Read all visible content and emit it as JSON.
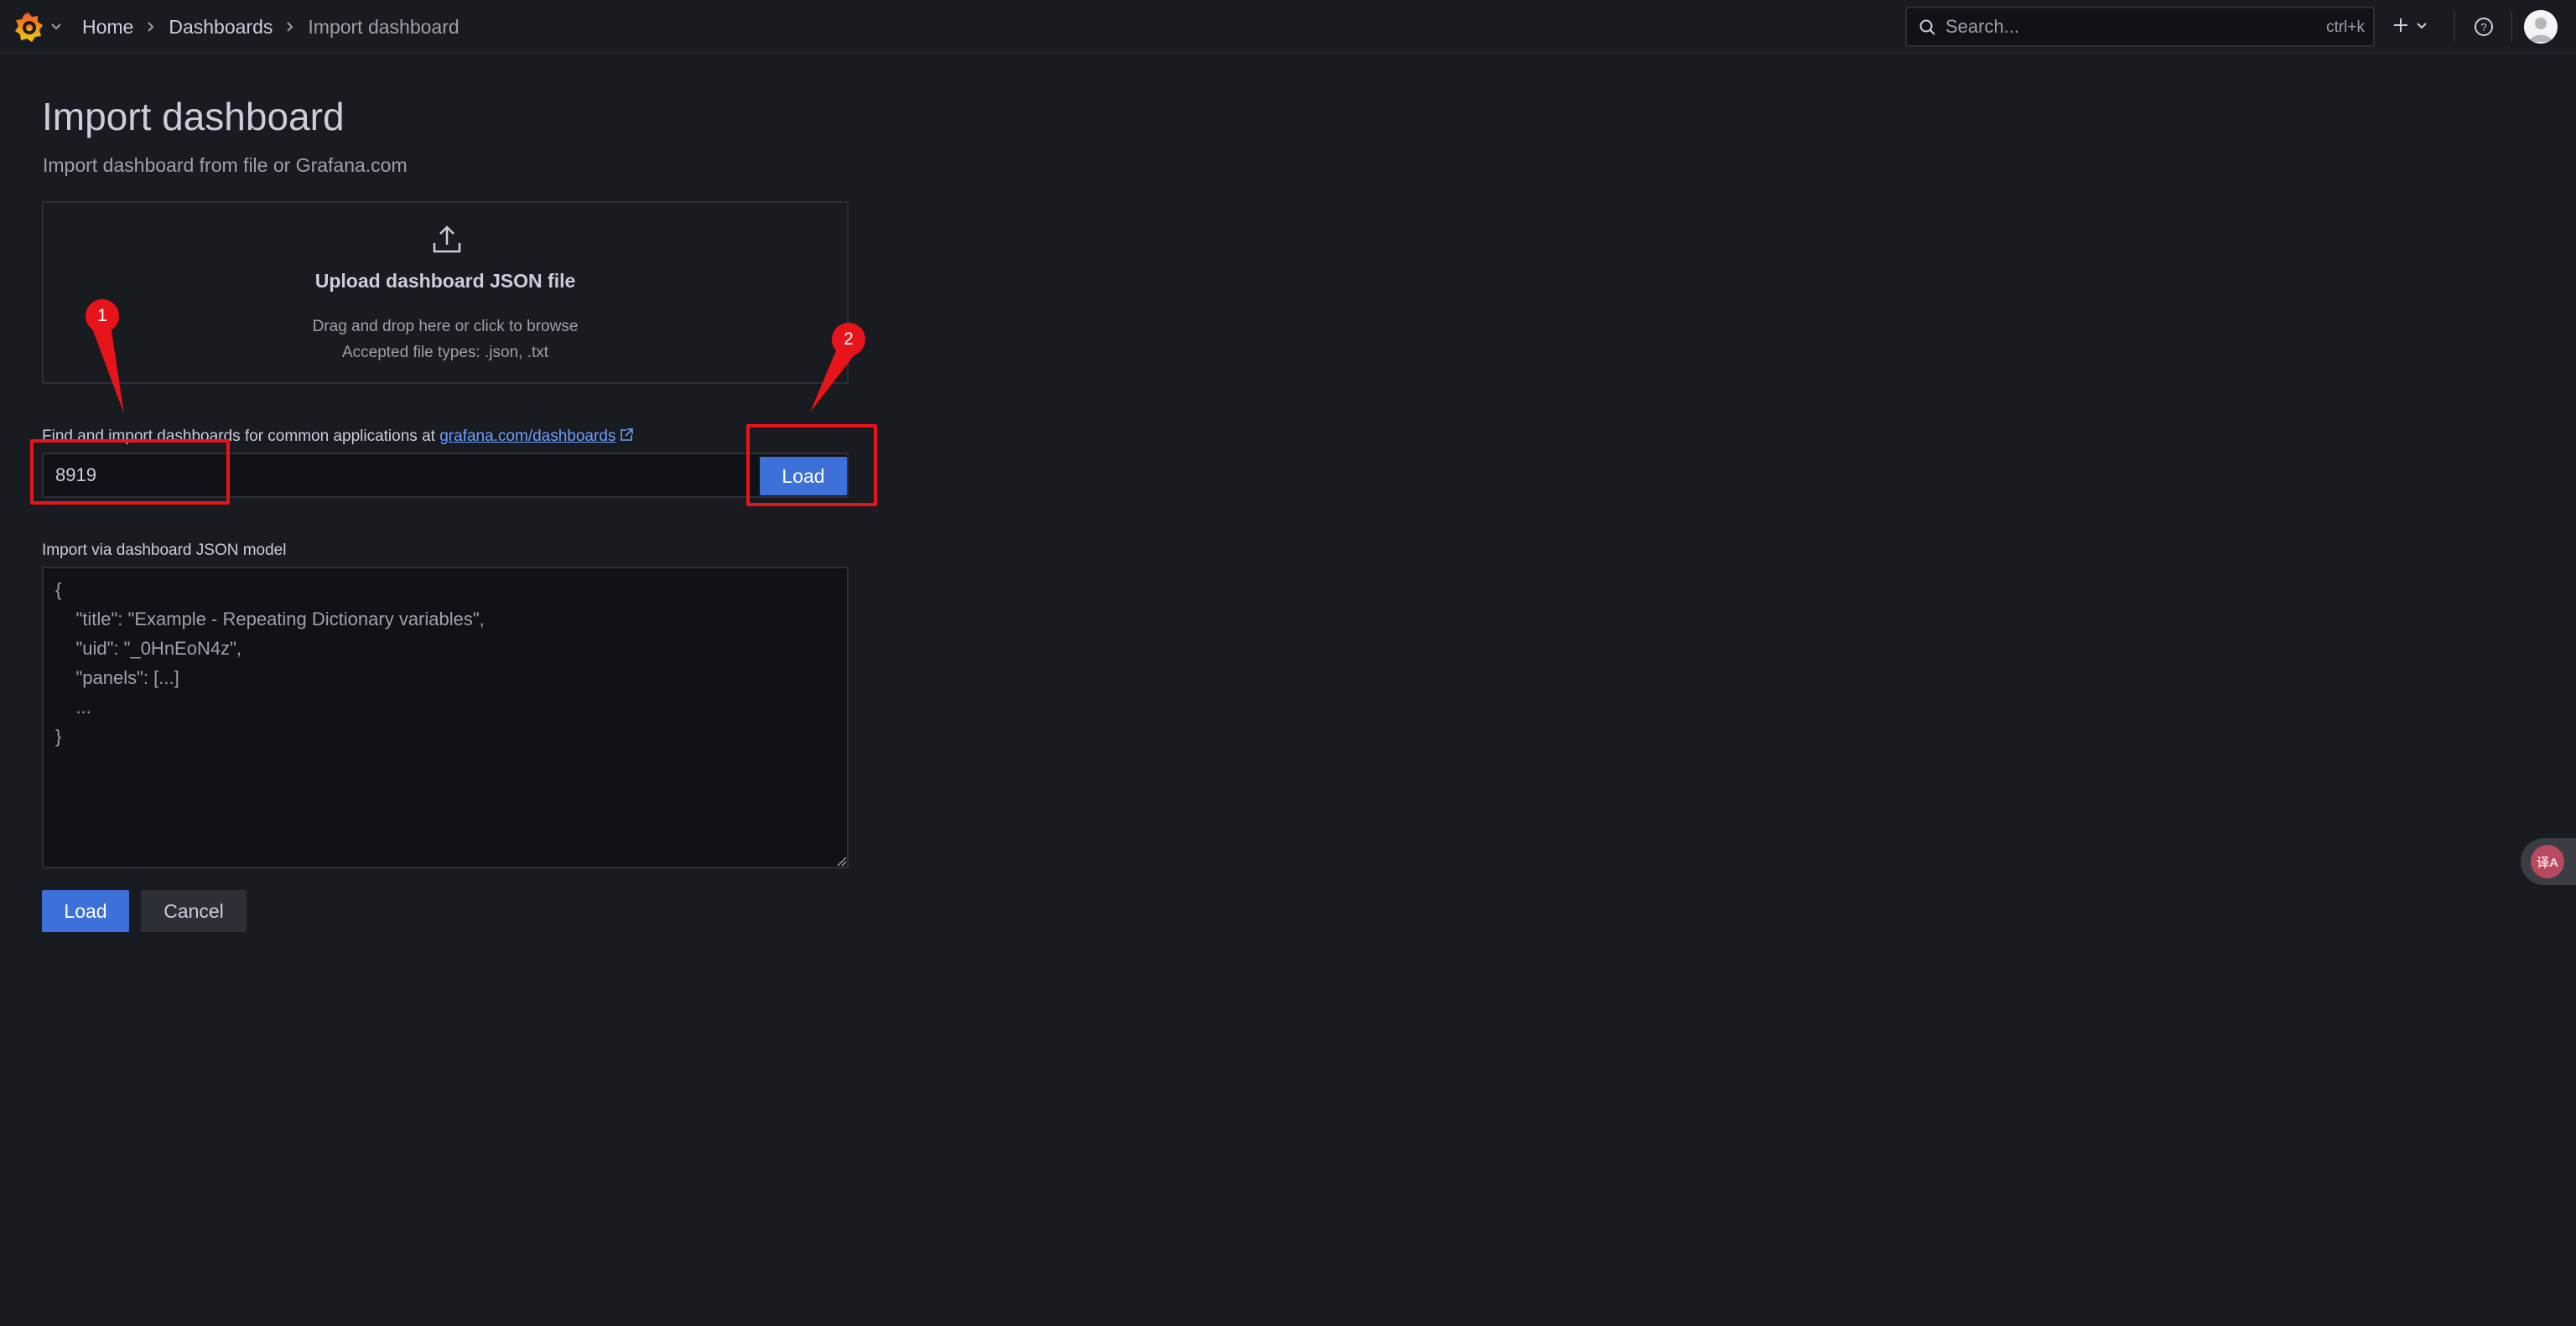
{
  "breadcrumb": {
    "home": "Home",
    "dashboards": "Dashboards",
    "current": "Import dashboard"
  },
  "search": {
    "placeholder": "Search...",
    "shortcut": "ctrl+k"
  },
  "icons": {
    "logo": "grafana-logo-icon",
    "search": "search-icon",
    "plus": "plus-icon",
    "help": "help-icon",
    "upload": "upload-icon",
    "external_link": "external-link-icon"
  },
  "page": {
    "title": "Import dashboard",
    "subtitle": "Import dashboard from file or Grafana.com"
  },
  "upload": {
    "title": "Upload dashboard JSON file",
    "hint_line1": "Drag and drop here or click to browse",
    "hint_line2": "Accepted file types: .json, .txt"
  },
  "grafana_com": {
    "label_prefix": "Find and import dashboards for common applications at ",
    "link_text": "grafana.com/dashboards",
    "input_value": "8919",
    "load_label": "Load"
  },
  "json_model": {
    "label": "Import via dashboard JSON model",
    "placeholder": "{\n    \"title\": \"Example - Repeating Dictionary variables\",\n    \"uid\": \"_0HnEoN4z\",\n    \"panels\": [...]\n    ...\n}"
  },
  "actions": {
    "load_label": "Load",
    "cancel_label": "Cancel"
  },
  "annotations": {
    "marker1": "1",
    "marker2": "2"
  },
  "float_widget": {
    "text": "译A"
  },
  "colors": {
    "background": "#181b1f",
    "primary_button": "#3d71d9",
    "link": "#6e9fff",
    "annotation_red": "#e8141b"
  }
}
